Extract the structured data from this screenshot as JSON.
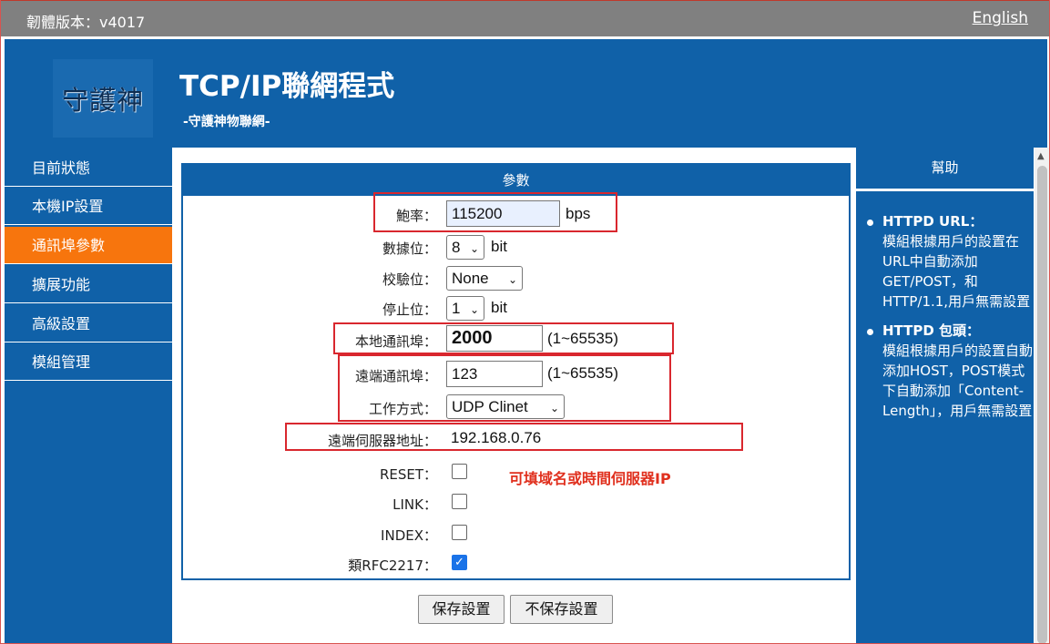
{
  "topbar": {
    "firmware": "韌體版本：v4017",
    "language_link": "English"
  },
  "header": {
    "logo_text": "守護神",
    "title": "TCP/IP聯網程式",
    "subtitle": "-守護神物聯網-"
  },
  "sidebar": {
    "items": [
      {
        "label": "目前狀態"
      },
      {
        "label": "本機IP設置"
      },
      {
        "label": "通訊埠參數",
        "active": true
      },
      {
        "label": "擴展功能"
      },
      {
        "label": "高級設置"
      },
      {
        "label": "模組管理"
      }
    ]
  },
  "panel": {
    "title": "參數",
    "baud": {
      "label": "鮑率：",
      "value": "115200",
      "unit": "bps"
    },
    "databits": {
      "label": "數據位：",
      "value": "8",
      "unit": "bit"
    },
    "parity": {
      "label": "校驗位：",
      "value": "None"
    },
    "stopbits": {
      "label": "停止位：",
      "value": "1",
      "unit": "bit"
    },
    "local_port": {
      "label": "本地通訊埠：",
      "value": "2000",
      "range": "(1~65535)"
    },
    "remote_port": {
      "label": "遠端通訊埠：",
      "value": "123",
      "range": "(1~65535)"
    },
    "work_mode": {
      "label": "工作方式：",
      "value": "UDP Clinet"
    },
    "server_addr": {
      "label": "遠端伺服器地址：",
      "value": "192.168.0.76"
    },
    "note": "可填域名或時間伺服器IP",
    "reset": {
      "label": "RESET：",
      "checked": false
    },
    "link": {
      "label": "LINK：",
      "checked": false
    },
    "index": {
      "label": "INDEX：",
      "checked": false
    },
    "rfc2217": {
      "label": "類RFC2217：",
      "checked": true,
      "check_glyph": "✓"
    }
  },
  "buttons": {
    "save": "保存設置",
    "nosave": "不保存設置"
  },
  "help": {
    "title": "幫助",
    "items": [
      {
        "heading": "HTTPD URL：",
        "text": "模組根據用戶的設置在URL中自動添加GET/POST，和HTTP/1.1,用戶無需設置"
      },
      {
        "heading": "HTTPD 包頭：",
        "text": "模組根據用戶的設置自動添加HOST，POST模式下自動添加「Content-Length」，用戶無需設置"
      }
    ]
  },
  "icons": {
    "select_arrow": "chevron-down-icon",
    "scroll_up": "scroll-up-arrow-icon"
  },
  "colors": {
    "brand_blue": "#1061a8",
    "active_orange": "#f7750d",
    "highlight_red": "#d9272e",
    "note_red": "#e0301e",
    "topbar_gray": "#808080"
  }
}
